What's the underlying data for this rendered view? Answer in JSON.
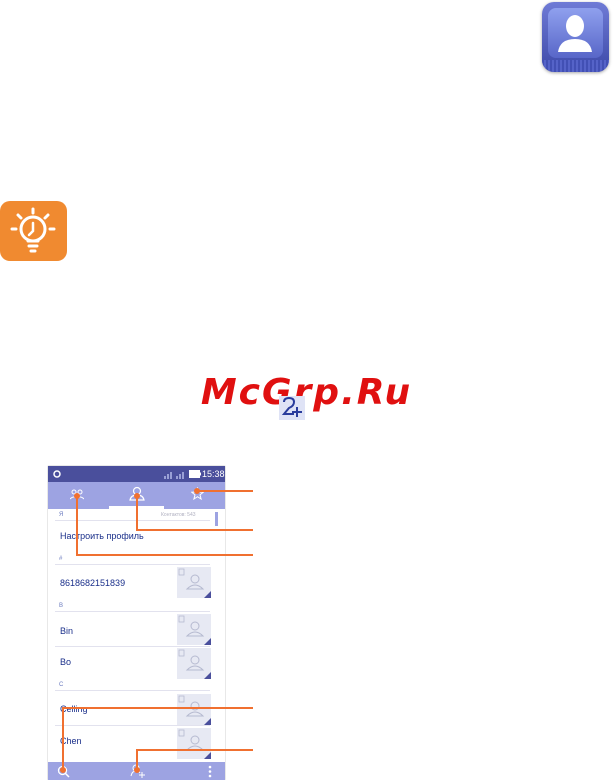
{
  "watermark": "McGrp.Ru",
  "phone": {
    "status": {
      "time": "15:38"
    },
    "list": {
      "header_section": "Я",
      "contacts_count": "Контактов: 543",
      "profile_label": "Настроить профиль",
      "groups": [
        {
          "section": "#",
          "names": [
            "8618682151839"
          ]
        },
        {
          "section": "B",
          "names": [
            "Bin",
            "Bo"
          ]
        },
        {
          "section": "C",
          "names": [
            "Celling",
            "Chen"
          ]
        }
      ]
    }
  },
  "colors": {
    "accent": "#f07030",
    "tab_bar": "#9da3e2",
    "status_bar": "#4a4f9c",
    "link_text": "#1a2f8a",
    "watermark": "#e01010",
    "tip_badge": "#f08a30"
  },
  "icons": [
    "contacts-app-icon",
    "tip-lightbulb-icon",
    "add-contact-icon",
    "groups-icon",
    "person-icon",
    "star-icon",
    "search-icon",
    "menu-dots-icon"
  ]
}
